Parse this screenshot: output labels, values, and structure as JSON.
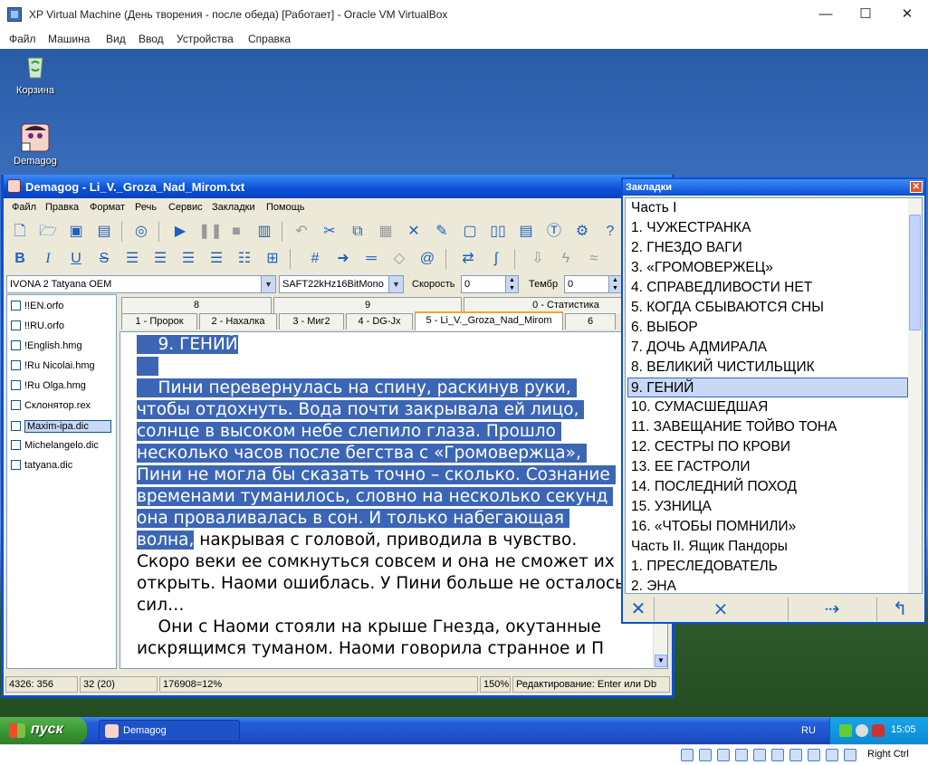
{
  "host": {
    "title": "XP Virtual Machine (День творения - после обеда) [Работает] - Oracle VM VirtualBox",
    "minimize": "—",
    "maximize": "☐",
    "close": "✕",
    "menu": [
      "Файл",
      "Машина",
      "Вид",
      "Ввод",
      "Устройства",
      "Справка"
    ],
    "status_key": "Right Ctrl"
  },
  "desktop": {
    "icons": [
      {
        "label": "Корзина",
        "icon": "recycle-bin-icon"
      },
      {
        "label": "Demagog",
        "icon": "demagog-shortcut-icon"
      }
    ]
  },
  "demagog": {
    "title": "Demagog - Li_V._Groza_Nad_Mirom.txt",
    "menu": [
      "Файл",
      "Правка",
      "Формат",
      "Речь",
      "Сервис",
      "Закладки",
      "Помощь"
    ],
    "voice": "IVONA 2 Tatyana OEM",
    "format": "SAFT22kHz16BitMono",
    "speed_label": "Скорость",
    "speed_value": "0",
    "timbre_label": "Тембр",
    "timbre_value": "0",
    "files": [
      {
        "name": "!!EN.orfo",
        "selected": false
      },
      {
        "name": "!!RU.orfo",
        "selected": false
      },
      {
        "name": "!English.hmg",
        "selected": false
      },
      {
        "name": "!Ru Nicolai.hmg",
        "selected": false
      },
      {
        "name": "!Ru Olga.hmg",
        "selected": false
      },
      {
        "name": "Склонятор.rex",
        "selected": false
      },
      {
        "name": "Maxim-ipa.dic",
        "selected": true
      },
      {
        "name": "Michelangelo.dic",
        "selected": false
      },
      {
        "name": "tatyana.dic",
        "selected": false
      }
    ],
    "tabs_top": [
      "8",
      "9",
      "0 - Статистика"
    ],
    "tabs_bottom": [
      "1 - Пророк",
      "2 - Нахалка",
      "3 - Миг2",
      "4 - DG-Jx",
      "5 - Li_V._Groza_Nad_Mirom",
      "6"
    ],
    "active_tab": "5 - Li_V._Groza_Nad_Mirom",
    "text": {
      "heading": "    9. ГЕНИЙ",
      "blank": "    ",
      "p1_sel": "    Пини перевернулась на спину, раскинув руки, чтобы отдохнуть. Вода почти закрывала ей лицо, солнце в высоком небе слепило глаза. Прошло несколько часов после бегства с «Громовержца», Пини не могла бы сказать точно – сколько. Сознание временами туманилось, словно на несколько секунд она проваливалась в сон. И только набегающая волна,",
      "p1_rest": " накрывая с головой, приводила в чувство. Скоро веки ее сомкнуться совсем и она не сможет их открыть. Наоми ошиблась. У Пини больше не осталось сил…",
      "p2": "    Они с Наоми стояли на крыше Гнезда, окутанные искрящимся туманом. Наоми говорила странное и П"
    },
    "status": [
      "4326: 356",
      "32 (20)",
      "176908=12%",
      "150%",
      "Редактирование: Enter или Db"
    ]
  },
  "bookmarks": {
    "title": "Закладки",
    "close": "✕",
    "items": [
      "Часть I",
      "1. ЧУЖЕСТРАНКА",
      "2. ГНЕЗДО ВАГИ",
      "3. «ГРОМОВЕРЖЕЦ»",
      "4. СПРАВЕДЛИВОСТИ НЕТ",
      "5. КОГДА СБЫВАЮТСЯ СНЫ",
      "6. ВЫБОР",
      "7. ДОЧЬ АДМИРАЛА",
      "8. ВЕЛИКИЙ ЧИСТИЛЬЩИК",
      "9. ГЕНИЙ",
      "10. СУМАСШЕДШАЯ",
      "11. ЗАВЕЩАНИЕ ТОЙВО ТОНА",
      "12. СЕСТРЫ ПО КРОВИ",
      "13. ЕЕ ГАСТРОЛИ",
      "14. ПОСЛЕДНИЙ ПОХОД",
      "15. УЗНИЦА",
      "16. «ЧТОБЫ ПОМНИЛИ»",
      "Часть II. Ящик Пандоры",
      "1. ПРЕСЛЕДОВАТЕЛЬ",
      "2. ЭНА"
    ],
    "selected_index": 9
  },
  "taskbar": {
    "start": "пуск",
    "task": "Demagog",
    "lang": "RU",
    "time": "15:05"
  }
}
